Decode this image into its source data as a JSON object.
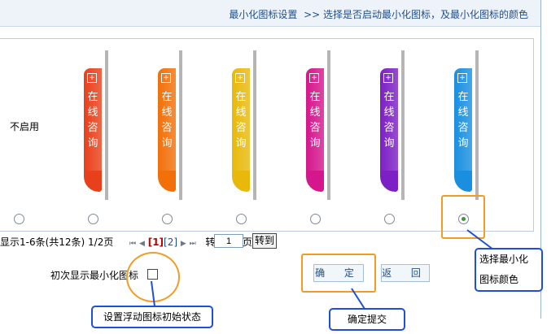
{
  "header": {
    "title": "最小化图标设置",
    "breadcrumb": ">> 选择是否启动最小化图标，及最小化图标的颜色"
  },
  "options": {
    "disable_label": "不启用",
    "tab_text": "在线咨询",
    "tab_plus": "+",
    "colors": [
      "#e8401a",
      "#f2700a",
      "#e8b90a",
      "#d4178c",
      "#7c1fc4",
      "#1a8fe0"
    ],
    "selected_index": 6
  },
  "pager": {
    "summary": "显示1-6条(共12条) 1/2页",
    "nav_first": "⏮",
    "nav_prev": "◀",
    "page1": "[1]",
    "page2": "[2]",
    "nav_next": "▶",
    "nav_last": "⏭",
    "goto_prefix": "转到第",
    "goto_value": "1",
    "goto_suffix": "页",
    "goto_button": "转到"
  },
  "initial": {
    "label": "初次显示最小化图标"
  },
  "buttons": {
    "confirm": "确 定",
    "back": "返 回"
  },
  "callouts": {
    "select_line1": "选择最小化",
    "select_line2": "图标颜色",
    "init_state": "设置浮动图标初始状态",
    "confirm_submit": "确定提交"
  }
}
